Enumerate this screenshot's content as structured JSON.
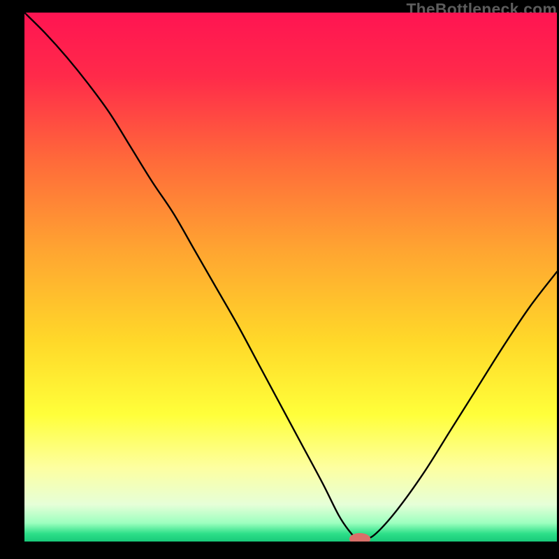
{
  "watermark": "TheBottleneck.com",
  "chart_data": {
    "type": "line",
    "title": "",
    "xlabel": "",
    "ylabel": "",
    "xlim": [
      0,
      100
    ],
    "ylim": [
      0,
      100
    ],
    "gradient_stops": [
      {
        "offset": 0.0,
        "color": "#ff1452"
      },
      {
        "offset": 0.12,
        "color": "#ff2a4a"
      },
      {
        "offset": 0.28,
        "color": "#ff6a3a"
      },
      {
        "offset": 0.45,
        "color": "#ffa531"
      },
      {
        "offset": 0.62,
        "color": "#ffd829"
      },
      {
        "offset": 0.76,
        "color": "#ffff3a"
      },
      {
        "offset": 0.86,
        "color": "#fdffa0"
      },
      {
        "offset": 0.93,
        "color": "#e6ffd8"
      },
      {
        "offset": 0.965,
        "color": "#9dffbf"
      },
      {
        "offset": 0.985,
        "color": "#2ee089"
      },
      {
        "offset": 1.0,
        "color": "#18c97a"
      }
    ],
    "series": [
      {
        "name": "bottleneck-curve",
        "x": [
          0,
          4,
          8,
          12,
          16,
          20,
          24,
          28,
          32,
          36,
          40,
          44,
          48,
          52,
          56,
          59,
          61,
          62.5,
          64,
          66,
          70,
          75,
          80,
          85,
          90,
          95,
          100
        ],
        "y": [
          100,
          96,
          91.5,
          86.5,
          81,
          74.5,
          68,
          62,
          55,
          48,
          41,
          33.5,
          26,
          18.5,
          11,
          5,
          2,
          0.5,
          0.5,
          1.5,
          6,
          13,
          21,
          29,
          37,
          44.5,
          51
        ]
      }
    ],
    "marker": {
      "name": "optimal-point",
      "x": 63,
      "y": 0.5,
      "rx": 2.0,
      "ry": 1.1,
      "color": "#d96f6a"
    }
  }
}
